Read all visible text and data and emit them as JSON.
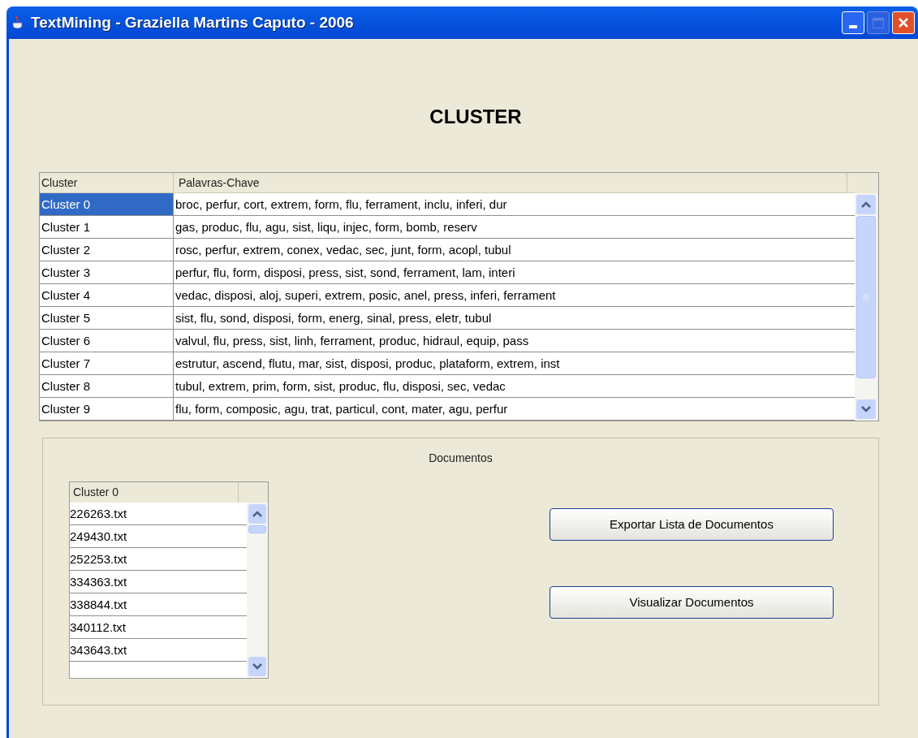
{
  "window": {
    "title": "TextMining - Graziella Martins Caputo - 2006"
  },
  "heading": "CLUSTER",
  "cluster_table": {
    "columns": [
      "Cluster",
      "Palavras-Chave"
    ],
    "rows": [
      {
        "cluster": "Cluster 0",
        "keywords": "broc, perfur, cort, extrem, form, flu, ferrament, inclu, inferi, dur",
        "selected": true
      },
      {
        "cluster": "Cluster 1",
        "keywords": "gas, produc, flu, agu, sist, liqu, injec, form, bomb, reserv",
        "selected": false
      },
      {
        "cluster": "Cluster 2",
        "keywords": "rosc, perfur, extrem, conex, vedac, sec, junt, form, acopl, tubul",
        "selected": false
      },
      {
        "cluster": "Cluster 3",
        "keywords": "perfur, flu, form, disposi, press, sist, sond, ferrament, lam, interi",
        "selected": false
      },
      {
        "cluster": "Cluster 4",
        "keywords": "vedac, disposi, aloj, superi, extrem, posic, anel, press, inferi, ferrament",
        "selected": false
      },
      {
        "cluster": "Cluster 5",
        "keywords": "sist, flu, sond, disposi, form, energ, sinal, press, eletr, tubul",
        "selected": false
      },
      {
        "cluster": "Cluster 6",
        "keywords": "valvul, flu, press, sist, linh, ferrament, produc, hidraul, equip, pass",
        "selected": false
      },
      {
        "cluster": "Cluster 7",
        "keywords": "estrutur, ascend, flutu, mar, sist, disposi, produc, plataform, extrem, inst",
        "selected": false
      },
      {
        "cluster": "Cluster 8",
        "keywords": "tubul, extrem, prim, form, sist, produc, flu, disposi, sec, vedac",
        "selected": false
      },
      {
        "cluster": "Cluster 9",
        "keywords": "flu, form, composic, agu, trat, particul, cont, mater, agu, perfur",
        "selected": false
      }
    ]
  },
  "documents": {
    "title": "Documentos",
    "list": {
      "column": "Cluster 0",
      "items": [
        "226263.txt",
        "249430.txt",
        "252253.txt",
        "334363.txt",
        "338844.txt",
        "340112.txt",
        "343643.txt"
      ]
    },
    "buttons": [
      "Exportar Lista de Documentos",
      "Visualizar Documentos"
    ]
  }
}
